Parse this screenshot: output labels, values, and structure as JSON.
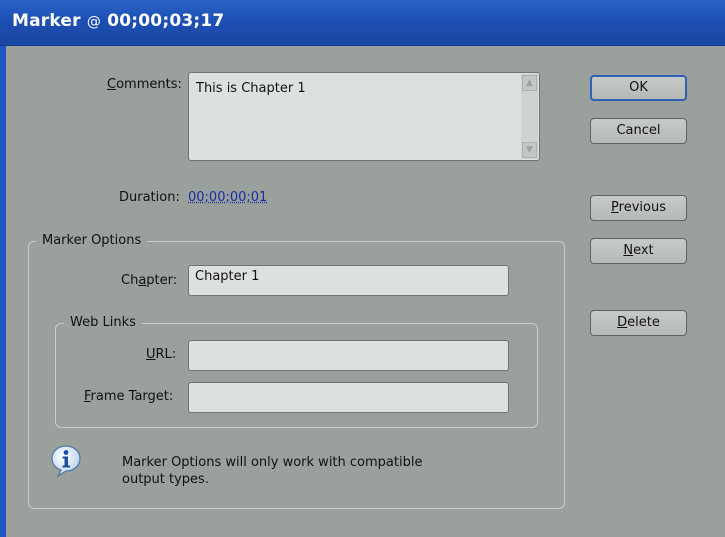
{
  "window": {
    "title_prefix": "Marker",
    "title_at": "@",
    "title_timecode": "00;00;03;17"
  },
  "comments": {
    "label_pre": "",
    "label_accel": "C",
    "label_post": "omments:",
    "value": "This is Chapter 1",
    "scroll_up_glyph": "▲",
    "scroll_down_glyph": "▼"
  },
  "duration": {
    "label": "Duration:",
    "value": "00;00;00;01"
  },
  "marker_options": {
    "legend": "Marker Options",
    "chapter": {
      "label_pre": "Ch",
      "label_accel": "a",
      "label_post": "pter:",
      "value": "Chapter 1"
    },
    "web_links": {
      "legend": "Web Links",
      "url": {
        "label_pre": "",
        "label_accel": "U",
        "label_post": "RL:",
        "value": ""
      },
      "frame_target": {
        "label_pre": "",
        "label_accel": "F",
        "label_post": "rame Target:",
        "value": ""
      }
    },
    "info_icon": "info-icon",
    "note_line1": "Marker Options will only work with compatible",
    "note_line2": "output types."
  },
  "buttons": {
    "ok": "OK",
    "cancel": "Cancel",
    "previous": {
      "pre": "",
      "accel": "P",
      "post": "revious"
    },
    "next": {
      "pre": "",
      "accel": "N",
      "post": "ext"
    },
    "delete": {
      "pre": "",
      "accel": "D",
      "post": "elete"
    }
  },
  "colors": {
    "title_bar": "#1d4fb3",
    "dialog_bg": "#9aa09b",
    "field_bg": "#dde1de",
    "link": "#1a2ea8"
  }
}
